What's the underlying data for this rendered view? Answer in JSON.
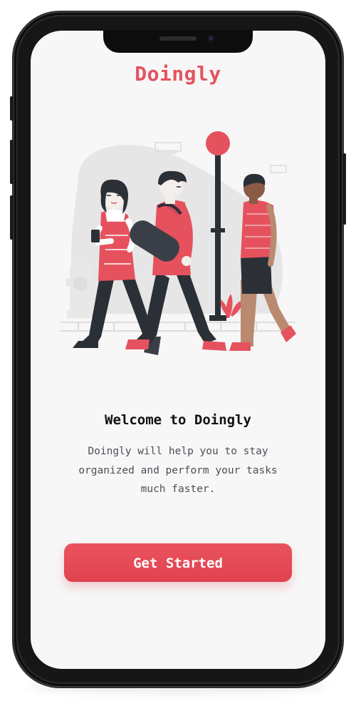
{
  "app": {
    "brand_name": "Doingly"
  },
  "onboarding": {
    "title": "Welcome to Doingly",
    "description": "Doingly will help you to stay organized and perform your tasks much faster.",
    "cta_label": "Get Started"
  },
  "illustration": {
    "subject": "people-walking-illustration"
  },
  "colors": {
    "accent": "#e5525e",
    "background": "#f7f7f7",
    "text_primary": "#111111",
    "text_secondary": "#4a4f57",
    "dark": "#2b2f36"
  }
}
